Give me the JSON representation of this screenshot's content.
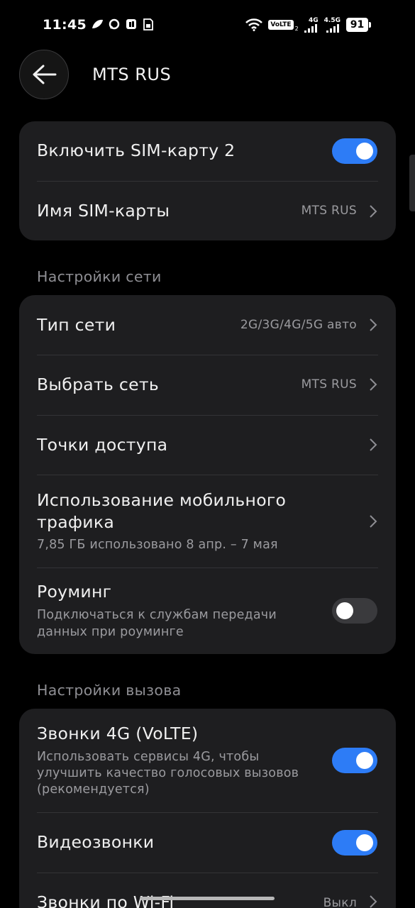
{
  "status_bar": {
    "time": "11:45",
    "volte": "VoLTE",
    "sim_index": "2",
    "net1": "4G",
    "net2": "4.5G",
    "battery": "91"
  },
  "header": {
    "title": "MTS RUS"
  },
  "sim_card": {
    "enable_label": "Включить SIM-карту 2",
    "enable_on": true,
    "name_label": "Имя SIM-карты",
    "name_value": "MTS RUS"
  },
  "network_settings": {
    "section_label": "Настройки сети",
    "network_type_label": "Тип сети",
    "network_type_value": "2G/3G/4G/5G авто",
    "select_network_label": "Выбрать сеть",
    "select_network_value": "MTS RUS",
    "apn_label": "Точки доступа",
    "data_usage_label_line1": "Использование мобильного",
    "data_usage_label_line2": "трафика",
    "data_usage_sub": "7,85 ГБ использовано 8 апр. – 7 мая",
    "roaming_label": "Роуминг",
    "roaming_sub_line1": "Подключаться к службам передачи",
    "roaming_sub_line2": "данных при роуминге",
    "roaming_on": false
  },
  "call_settings": {
    "section_label": "Настройки вызова",
    "volte_label": "Звонки 4G (VoLTE)",
    "volte_sub_line1": "Использовать сервисы 4G, чтобы",
    "volte_sub_line2": "улучшить качество голосовых вызовов",
    "volte_sub_line3": "(рекомендуется)",
    "volte_on": true,
    "video_label": "Видеозвонки",
    "video_on": true,
    "wifi_calls_label": "Звонки по Wi-Fi",
    "wifi_calls_value": "Выкл"
  },
  "colors": {
    "accent": "#2D7CF6",
    "card": "#1E1E20",
    "background": "#000000"
  }
}
